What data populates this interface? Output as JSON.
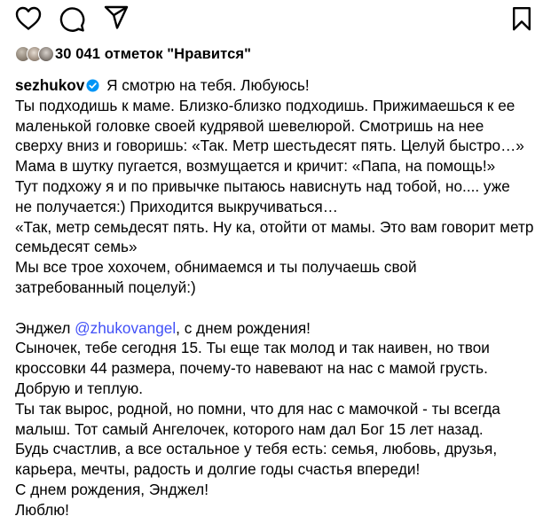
{
  "actions": {
    "like_icon": "heart-outline-icon",
    "comment_icon": "speech-bubble-icon",
    "share_icon": "paper-plane-icon",
    "save_icon": "bookmark-icon"
  },
  "likes": {
    "text": "30 041 отметок \"Нравится\""
  },
  "post": {
    "username": "sezhukov",
    "first_line": " Я смотрю на тебя. Любуюсь!",
    "lines": [
      "Ты подходишь к маме. Близко-близко подходишь. Прижимаешься к ее",
      "маленькой головке своей кудрявой шевелюрой. Смотришь на нее",
      "сверху вниз и говоришь: «Так. Метр шестьдесят пять. Целуй быстро…»",
      "Мама в шутку пугается, возмущается и кричит: «Папа, на помощь!»",
      "Тут подхожу я и по привычке пытаюсь нависнуть над тобой, но.... уже",
      "не получается:) Приходится выкручиваться…",
      "«Так, метр семьдесят пять. Ну ка, отойти от мамы. Это вам говорит метр",
      "семьдесят семь»",
      "Мы все трое хохочем, обнимаемся и ты получаешь свой",
      "затребованный поцелуй:)",
      ""
    ],
    "angel_prefix": "Энджел ",
    "mention": "@zhukovangel",
    "angel_suffix": ", с днем рождения!",
    "lines2": [
      "Сыночек, тебе сегодня 15. Ты еще так молод и так наивен, но твои",
      "кроссовки 44 размера, почему-то навевают на нас с мамой грусть.",
      "Добрую и теплую.",
      "Ты так вырос, родной, но помни, что для нас с мамочкой - ты всегда",
      "малыш. Тот самый Ангелочек, которого нам дал Бог 15 лет назад.",
      "Будь счастлив, а все остальное у тебя есть: семья, любовь, друзья,",
      "карьера, мечты, радость и долгие годы счастья впереди!",
      "С днем рождения, Энджел!",
      "Люблю!"
    ]
  },
  "colors": {
    "text": "#000000",
    "mention": "#4150f7",
    "verified": "#0095f6"
  }
}
